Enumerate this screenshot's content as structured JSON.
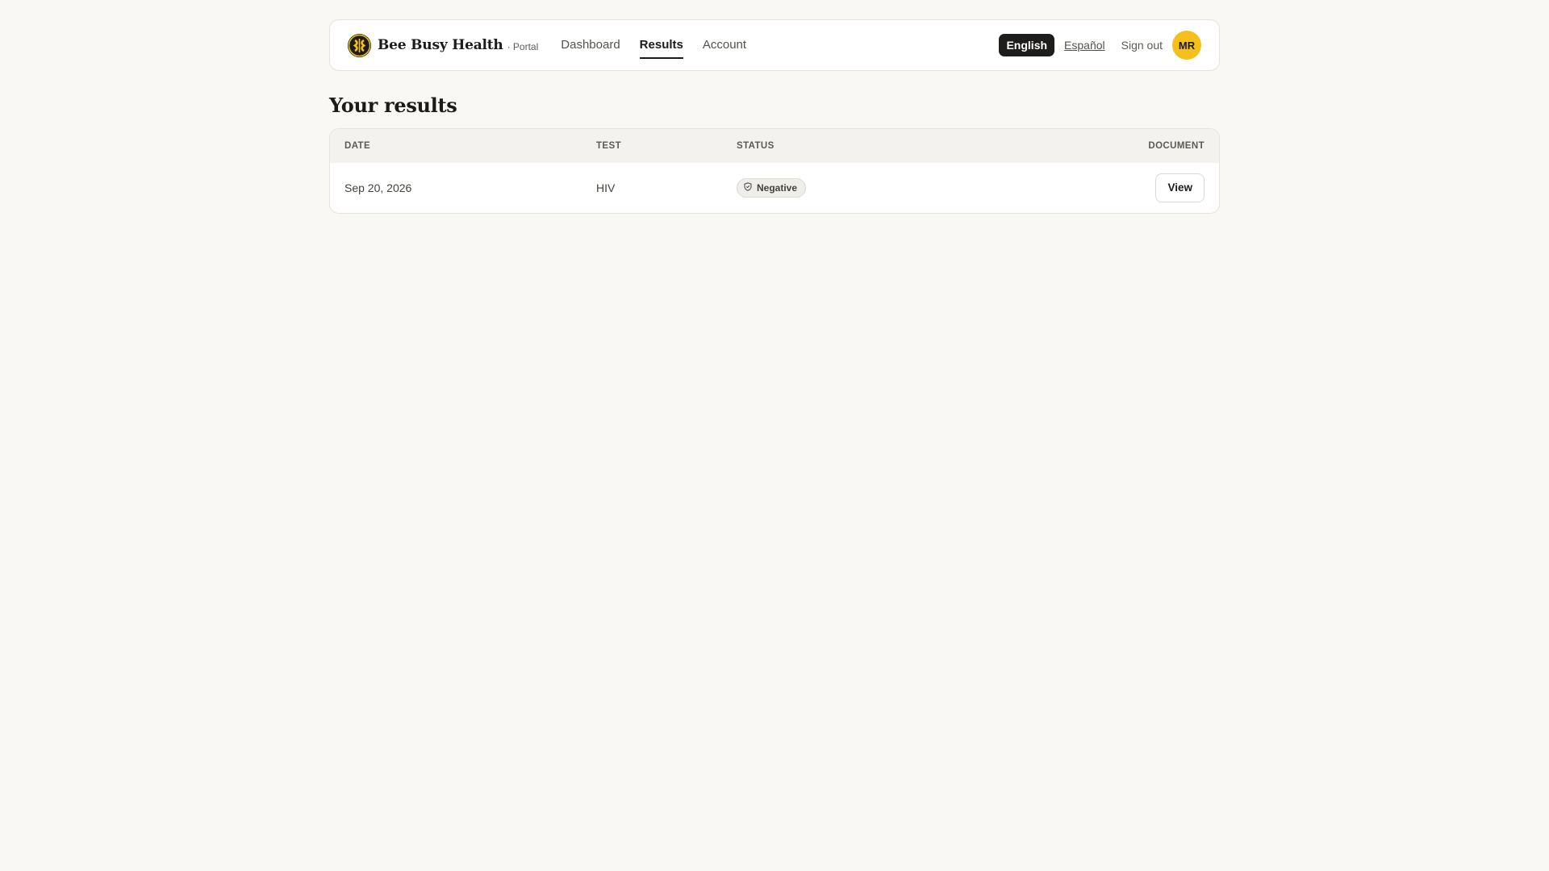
{
  "header": {
    "brand_name": "Bee Busy Health",
    "brand_sub": "· Portal",
    "nav": [
      {
        "label": "Dashboard",
        "active": false
      },
      {
        "label": "Results",
        "active": true
      },
      {
        "label": "Account",
        "active": false
      }
    ],
    "lang_active": "English",
    "lang_other": "Español",
    "signout": "Sign out",
    "avatar_initials": "MR"
  },
  "page": {
    "title": "Your results"
  },
  "table": {
    "headers": [
      "DATE",
      "TEST",
      "STATUS",
      "DOCUMENT"
    ],
    "rows": [
      {
        "date": "Sep 20, 2026",
        "test": "HIV",
        "status": "Negative",
        "status_icon": "shield-icon",
        "document_action": "View"
      }
    ]
  },
  "colors": {
    "background": "#f9f8f5",
    "accent": "#f6c01a",
    "dark": "#1e1d1b"
  }
}
